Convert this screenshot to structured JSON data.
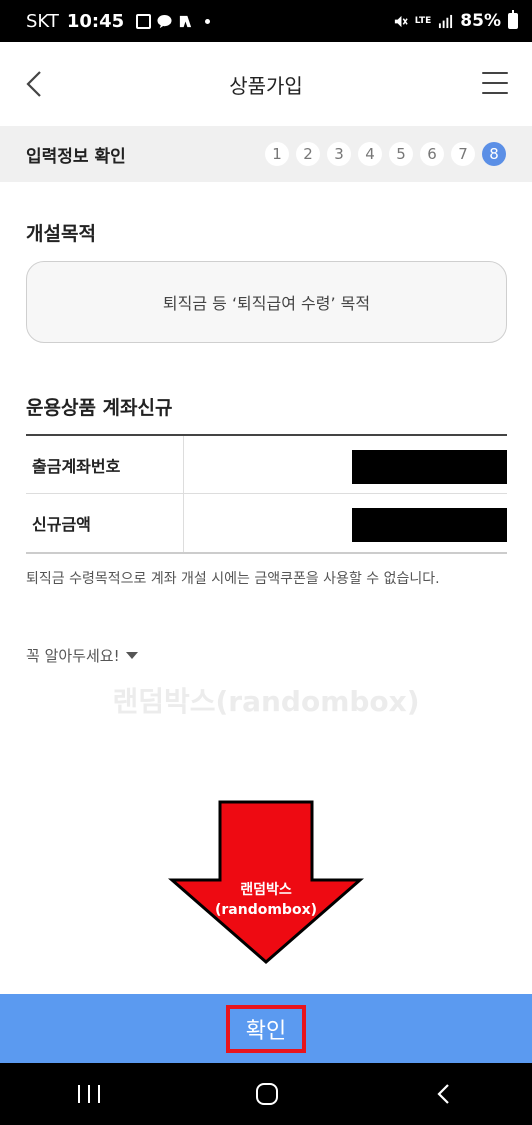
{
  "status_bar": {
    "carrier": "SKT",
    "time": "10:45",
    "network": "LTE",
    "battery": "85%"
  },
  "header": {
    "title": "상품가입"
  },
  "step_bar": {
    "title": "입력정보 확인",
    "steps": [
      "1",
      "2",
      "3",
      "4",
      "5",
      "6",
      "7",
      "8"
    ],
    "active_step": "8"
  },
  "purpose": {
    "title": "개설목적",
    "value": "퇴직금 등 ‘퇴직급여 수령’ 목적"
  },
  "account": {
    "title": "운용상품 계좌신규",
    "rows": [
      {
        "label": "출금계좌번호"
      },
      {
        "label": "신규금액"
      }
    ]
  },
  "notice": "퇴직금 수령목적으로 계좌 개설 시에는 금액쿠폰을 사용할 수 없습니다.",
  "must_know": "꼭 알아두세요!",
  "watermark": "랜덤박스(randombox)",
  "arrow_label": {
    "line1": "랜덤박스",
    "line2": "(randombox)"
  },
  "confirm": {
    "label": "확인"
  },
  "colors": {
    "accent": "#5b9af0",
    "active_step": "#5b8fe6",
    "highlight": "#e8141c"
  }
}
